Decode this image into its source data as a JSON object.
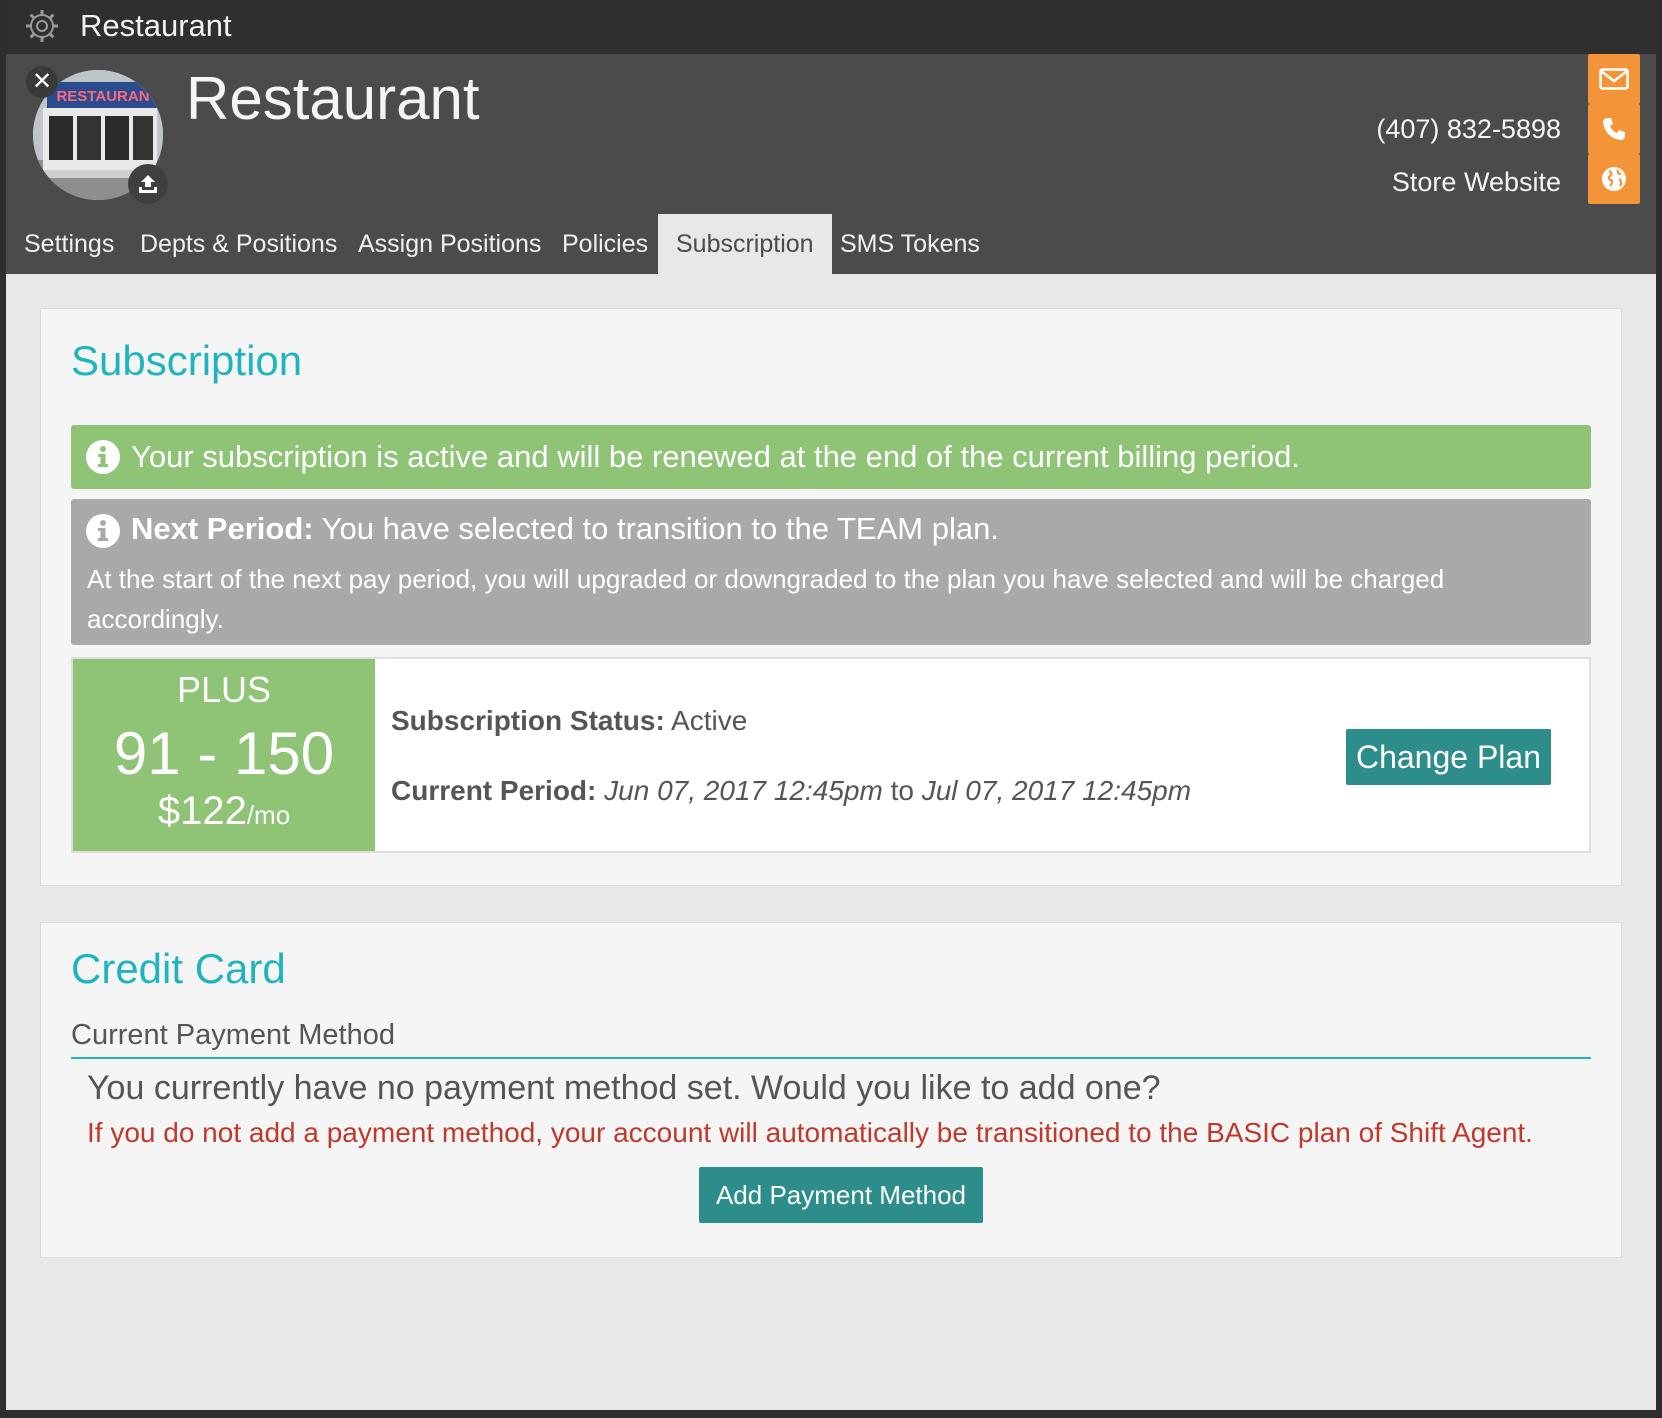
{
  "window": {
    "title": "Restaurant"
  },
  "header": {
    "store_name": "Restaurant",
    "phone": "(407) 832-5898",
    "website_label": "Store Website",
    "avatar_sign": "RESTAURAN",
    "accent_color": "#f39438"
  },
  "tabs": [
    {
      "label": "Settings",
      "active": false
    },
    {
      "label": "Depts & Positions",
      "active": false
    },
    {
      "label": "Assign Positions",
      "active": false
    },
    {
      "label": "Policies",
      "active": false
    },
    {
      "label": "Subscription",
      "active": true
    },
    {
      "label": "SMS Tokens",
      "active": false
    }
  ],
  "subscription": {
    "heading": "Subscription",
    "active_alert": "Your subscription is active and will be renewed at the end of the current billing period.",
    "next_period": {
      "label": "Next Period:",
      "text": "You have selected to transition to the TEAM plan.",
      "detail": "At the start of the next pay period, you will upgraded or downgraded to the plan you have selected and will be charged accordingly."
    },
    "plan": {
      "name": "PLUS",
      "range": "91 - 150",
      "price": "$122",
      "per": "/mo"
    },
    "status_label": "Subscription Status:",
    "status_value": "Active",
    "period_label": "Current Period:",
    "period_start": "Jun 07, 2017 12:45pm",
    "period_to": "to",
    "period_end": "Jul 07, 2017 12:45pm",
    "change_plan_label": "Change Plan"
  },
  "credit_card": {
    "heading": "Credit Card",
    "subheading": "Current Payment Method",
    "no_method": "You currently have no payment method set. Would you like to add one?",
    "warning": "If you do not add a payment method, your account will automatically be transitioned to the BASIC plan of Shift Agent.",
    "add_label": "Add Payment Method"
  },
  "colors": {
    "teal_heading": "#20b5be",
    "teal_button": "#2d8d8a",
    "green": "#8fc477",
    "warning_red": "#c0392b"
  }
}
